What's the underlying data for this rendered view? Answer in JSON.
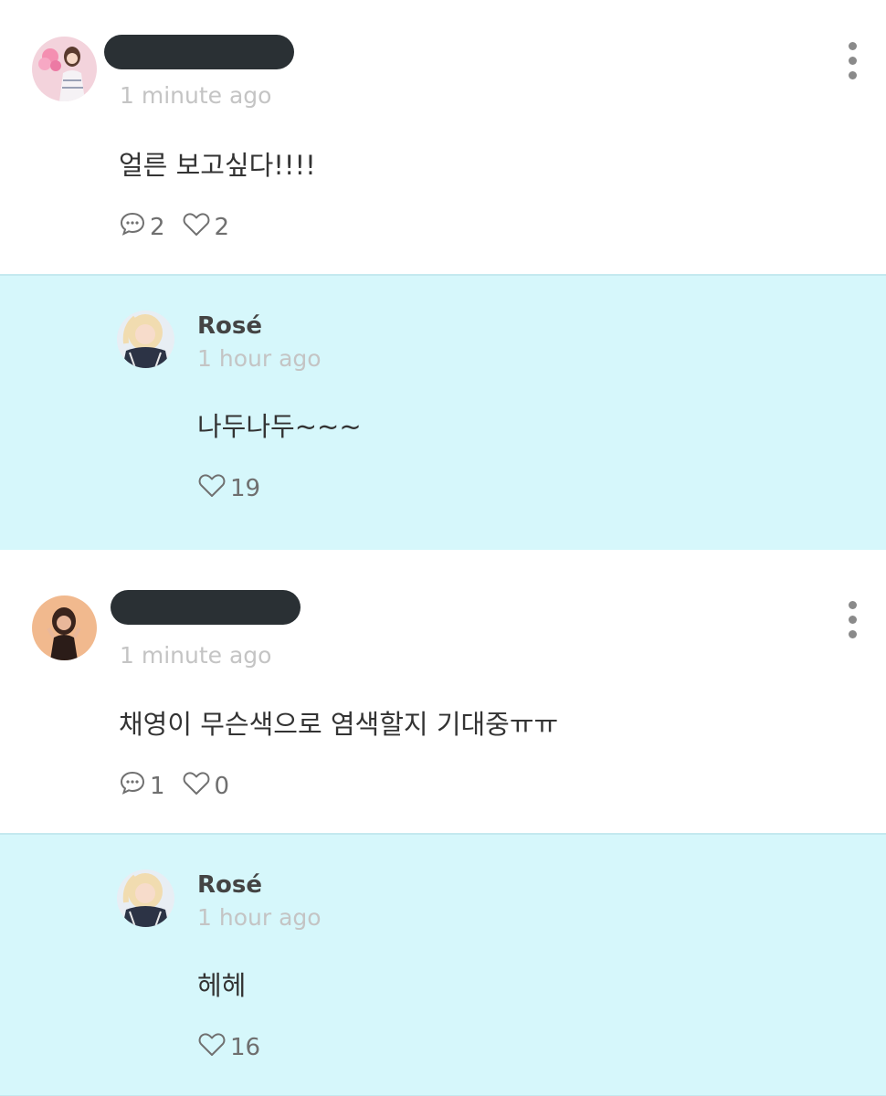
{
  "comments": [
    {
      "time": "1 minute ago",
      "text": "얼른 보고싶다!!!!",
      "reply_count": "2",
      "like_count": "2",
      "reply": {
        "author": "Rosé",
        "time": "1 hour ago",
        "text": "나두나두~~~",
        "like_count": "19"
      }
    },
    {
      "time": "1 minute ago",
      "text": "채영이 무슨색으로 염색할지 기대중ㅠㅠ",
      "reply_count": "1",
      "like_count": "0",
      "reply": {
        "author": "Rosé",
        "time": "1 hour ago",
        "text": "헤헤",
        "like_count": "16"
      }
    }
  ],
  "icons": {
    "comment": "speech-bubble-icon",
    "like": "heart-outline-icon",
    "more": "vertical-ellipsis-icon"
  },
  "colors": {
    "reply_background": "#d6f7fb",
    "redaction": "#2a3034",
    "timestamp": "#c4c4c4"
  }
}
